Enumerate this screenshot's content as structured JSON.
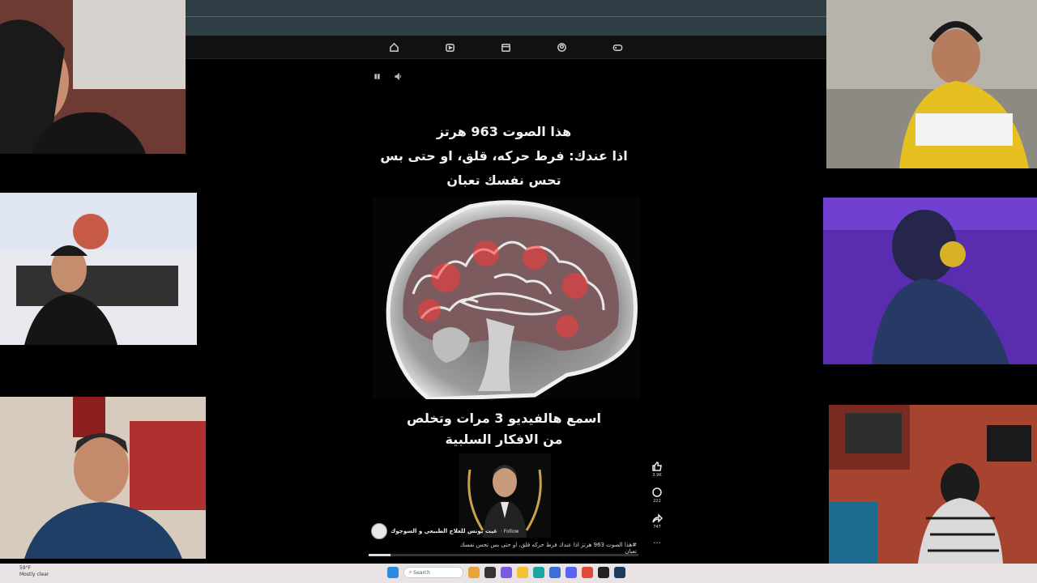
{
  "video": {
    "caption_lines": [
      "هذا الصوت 963 هرتز",
      "اذا عندك: فرط حركه، قلق، او حتى بس",
      "تحس نفسك تعبان"
    ],
    "caption_bottom_lines": [
      "اسمع هالفيديو 3 مرات وتخلص",
      "من الافكار السلبية"
    ],
    "channel_name": "غيث يونس للعلاج الطبيعي و السوجوك",
    "follow_label": "· Follow",
    "description": "#هذا الصوت 963 هرتز اذا عندك فرط حركه قلق، او حتى بس تحس نفسك تعبان",
    "likes": "3.9K",
    "comments": "222",
    "shares": "747",
    "progress": 0.08
  },
  "nav": {
    "icons": [
      "home-icon",
      "shorts-icon",
      "store-icon",
      "profile-icon",
      "game-icon"
    ]
  },
  "taskbar": {
    "weather_temp": "59°F",
    "weather_desc": "Mostly clear",
    "search_placeholder": "Search"
  },
  "colors": {
    "background": "#000000",
    "chrome": "#2f3d44",
    "taskbar": "#e9e3e6"
  }
}
